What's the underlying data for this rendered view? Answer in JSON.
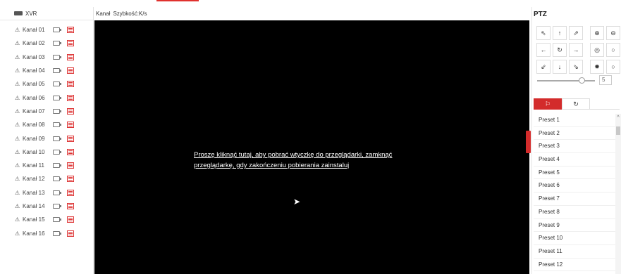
{
  "device": {
    "name": "XVR"
  },
  "channels": [
    {
      "label": "Kanał 01"
    },
    {
      "label": "Kanał 02"
    },
    {
      "label": "Kanał 03"
    },
    {
      "label": "Kanał 04"
    },
    {
      "label": "Kanał 05"
    },
    {
      "label": "Kanał 06"
    },
    {
      "label": "Kanał 07"
    },
    {
      "label": "Kanał 08"
    },
    {
      "label": "Kanał 09"
    },
    {
      "label": "Kanał 10"
    },
    {
      "label": "Kanał 11"
    },
    {
      "label": "Kanał 12"
    },
    {
      "label": "Kanał 13"
    },
    {
      "label": "Kanał 14"
    },
    {
      "label": "Kanał 15"
    },
    {
      "label": "Kanał 16"
    }
  ],
  "viewbar": {
    "channel_label": "Kanał",
    "speed_label": "Szybkość:K/s"
  },
  "video": {
    "plugin_message": "Proszę kliknąć tutaj, aby pobrać wtyczkę do przeglądarki, zamknąć przeglądarkę, gdy zakończeniu pobierania zainstaluj"
  },
  "ptz": {
    "title": "PTZ",
    "speed_value": "5",
    "speed_level": 5,
    "buttons": [
      {
        "icon": "arrow-up-left-icon",
        "glyph": "⇖"
      },
      {
        "icon": "arrow-up-icon",
        "glyph": "↑"
      },
      {
        "icon": "arrow-up-right-icon",
        "glyph": "⇗"
      },
      {
        "icon": "zoom-in-icon",
        "glyph": "⊕"
      },
      {
        "icon": "zoom-out-icon",
        "glyph": "⊖"
      },
      {
        "icon": "arrow-left-icon",
        "glyph": "←"
      },
      {
        "icon": "rotate-icon",
        "glyph": "↻"
      },
      {
        "icon": "arrow-right-icon",
        "glyph": "→"
      },
      {
        "icon": "focus-near-icon",
        "glyph": "◎"
      },
      {
        "icon": "focus-far-icon",
        "glyph": "○"
      },
      {
        "icon": "arrow-down-left-icon",
        "glyph": "⇙"
      },
      {
        "icon": "arrow-down-icon",
        "glyph": "↓"
      },
      {
        "icon": "arrow-down-right-icon",
        "glyph": "⇘"
      },
      {
        "icon": "iris-open-icon",
        "glyph": "✹"
      },
      {
        "icon": "iris-close-icon",
        "glyph": "○"
      }
    ],
    "tabs": [
      {
        "icon": "flag-icon",
        "glyph": "⚐"
      },
      {
        "icon": "cruise-icon",
        "glyph": "↻"
      }
    ],
    "presets": [
      "Preset 1",
      "Preset 2",
      "Preset 3",
      "Preset 4",
      "Preset 5",
      "Preset 6",
      "Preset 7",
      "Preset 8",
      "Preset 9",
      "Preset 10",
      "Preset 11",
      "Preset 12"
    ]
  },
  "colors": {
    "accent": "#d32b2b",
    "video_bg": "#000000"
  }
}
